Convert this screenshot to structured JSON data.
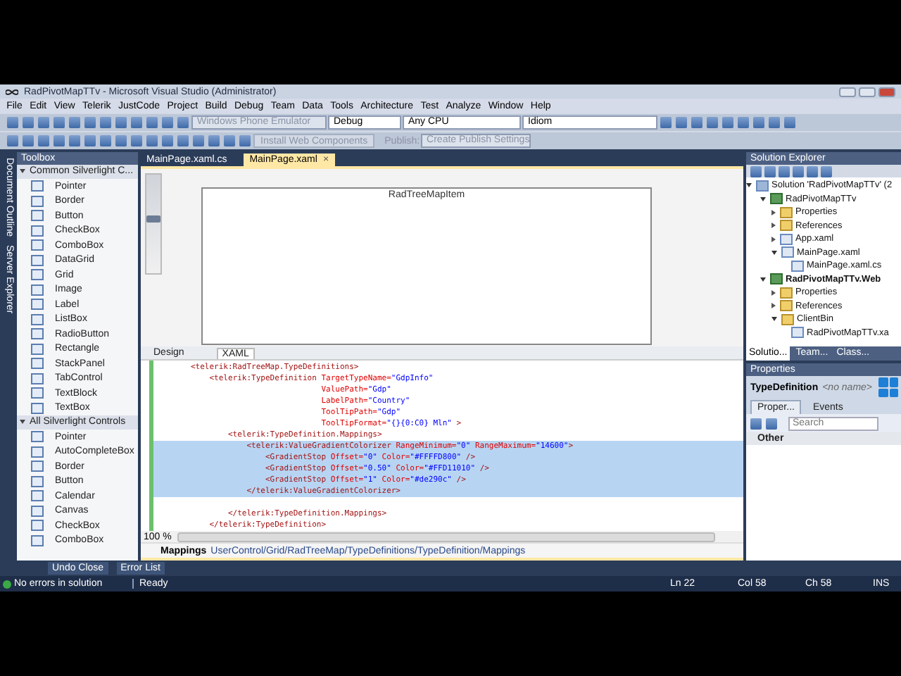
{
  "window": {
    "title": "RadPivotMapTTv - Microsoft Visual Studio (Administrator)"
  },
  "menu": [
    "File",
    "Edit",
    "View",
    "Telerik",
    "JustCode",
    "Project",
    "Build",
    "Debug",
    "Team",
    "Data",
    "Tools",
    "Architecture",
    "Test",
    "Analyze",
    "Window",
    "Help"
  ],
  "toolbar_1": {
    "combos": [
      {
        "value": "Windows Phone Emulator",
        "disabled": true
      },
      {
        "value": "Debug",
        "disabled": false
      },
      {
        "value": "Any CPU",
        "disabled": false
      },
      {
        "value": "Idiom",
        "disabled": false
      }
    ]
  },
  "toolbar_2": {
    "install_button": {
      "label": "Install Web Components",
      "disabled": true
    },
    "publish_label": "Publish:",
    "publish_combo": {
      "value": "Create Publish Settings",
      "disabled": true
    }
  },
  "side_tabs": [
    "Document Outline",
    "Server Explorer"
  ],
  "toolbox": {
    "title": "Toolbox",
    "groups": [
      {
        "label": "Common Silverlight C...",
        "expanded": true,
        "items": [
          "Pointer",
          "Border",
          "Button",
          "CheckBox",
          "ComboBox",
          "DataGrid",
          "Grid",
          "Image",
          "Label",
          "ListBox",
          "RadioButton",
          "Rectangle",
          "StackPanel",
          "TabControl",
          "TextBlock",
          "TextBox"
        ]
      },
      {
        "label": "All Silverlight Controls",
        "expanded": true,
        "items": [
          "Pointer",
          "AutoCompleteBox",
          "Border",
          "Button",
          "Calendar",
          "Canvas",
          "CheckBox",
          "ComboBox"
        ]
      }
    ]
  },
  "document_tabs": [
    {
      "label": "MainPage.xaml.cs",
      "selected": false
    },
    {
      "label": "MainPage.xaml",
      "selected": true,
      "close": "×"
    }
  ],
  "designer": {
    "item_label": "RadTreeMapItem",
    "zoom": {
      "level": 0.55
    }
  },
  "view_tabs": [
    {
      "label": "Design",
      "selected": false
    },
    {
      "label": "XAML",
      "selected": true
    }
  ],
  "code_lines": [
    {
      "selected": false,
      "tokens": [
        {
          "kind": "tag",
          "text": "        <telerik:RadTreeMap.TypeDefinitions>"
        }
      ]
    },
    {
      "selected": false,
      "tokens": [
        {
          "kind": "tag",
          "text": "            <telerik:TypeDefinition"
        },
        {
          "kind": "attr",
          "text": " TargetTypeName="
        },
        {
          "kind": "value",
          "text": "\"GdpInfo\""
        }
      ]
    },
    {
      "selected": false,
      "tokens": [
        {
          "kind": "attr",
          "text": "                                    ValuePath="
        },
        {
          "kind": "value",
          "text": "\"Gdp\""
        }
      ]
    },
    {
      "selected": false,
      "tokens": [
        {
          "kind": "attr",
          "text": "                                    LabelPath="
        },
        {
          "kind": "value",
          "text": "\"Country\""
        }
      ]
    },
    {
      "selected": false,
      "tokens": [
        {
          "kind": "attr",
          "text": "                                    ToolTipPath="
        },
        {
          "kind": "value",
          "text": "\"Gdp\""
        }
      ]
    },
    {
      "selected": false,
      "tokens": [
        {
          "kind": "attr",
          "text": "                                    ToolTipFormat="
        },
        {
          "kind": "value",
          "text": "\"{}{0:C0} Mln\""
        },
        {
          "kind": "tag",
          "text": " >"
        }
      ]
    },
    {
      "selected": false,
      "tokens": [
        {
          "kind": "tag",
          "text": "                <telerik:TypeDefinition.Mappings>"
        }
      ]
    },
    {
      "selected": true,
      "tokens": [
        {
          "kind": "tag",
          "text": "                    <telerik:ValueGradientColorizer"
        },
        {
          "kind": "attr",
          "text": " RangeMinimum="
        },
        {
          "kind": "value",
          "text": "\"0\""
        },
        {
          "kind": "attr",
          "text": " RangeMaximum="
        },
        {
          "kind": "value",
          "text": "\"14600\""
        },
        {
          "kind": "tag",
          "text": ">"
        }
      ]
    },
    {
      "selected": true,
      "tokens": [
        {
          "kind": "tag",
          "text": "                        <GradientStop"
        },
        {
          "kind": "attr",
          "text": " Offset="
        },
        {
          "kind": "value",
          "text": "\"0\""
        },
        {
          "kind": "attr",
          "text": " Color="
        },
        {
          "kind": "value",
          "text": "\"#FFFFD800\""
        },
        {
          "kind": "tag",
          "text": " />"
        }
      ]
    },
    {
      "selected": true,
      "tokens": [
        {
          "kind": "tag",
          "text": "                        <GradientStop"
        },
        {
          "kind": "attr",
          "text": " Offset="
        },
        {
          "kind": "value",
          "text": "\"0.50\""
        },
        {
          "kind": "attr",
          "text": " Color="
        },
        {
          "kind": "value",
          "text": "\"#FFD11010\""
        },
        {
          "kind": "tag",
          "text": " />"
        }
      ]
    },
    {
      "selected": true,
      "tokens": [
        {
          "kind": "tag",
          "text": "                        <GradientStop"
        },
        {
          "kind": "attr",
          "text": " Offset="
        },
        {
          "kind": "value",
          "text": "\"1\""
        },
        {
          "kind": "attr",
          "text": " Color="
        },
        {
          "kind": "value",
          "text": "\"#de290c\""
        },
        {
          "kind": "tag",
          "text": " />"
        }
      ]
    },
    {
      "selected": true,
      "tokens": [
        {
          "kind": "tag",
          "text": "                    </telerik:ValueGradientColorizer>"
        }
      ]
    },
    {
      "selected": false
    },
    {
      "selected": false,
      "tokens": [
        {
          "kind": "tag",
          "text": "                </telerik:TypeDefinition.Mappings>"
        }
      ]
    },
    {
      "selected": false,
      "tokens": [
        {
          "kind": "tag",
          "text": "            </telerik:TypeDefinition>"
        }
      ]
    }
  ],
  "zoom_level": "100 %",
  "breadcrumb": {
    "element": "Mappings",
    "path": "UserControl/Grid/RadTreeMap/TypeDefinitions/TypeDefinition/Mappings"
  },
  "solution_explorer": {
    "title": "Solution Explorer",
    "tree": [
      {
        "label": "Solution 'RadPivotMapTTv' (2",
        "kind": "solution",
        "bold": false,
        "expanded": true,
        "children": [
          {
            "label": "RadPivotMapTTv",
            "kind": "project",
            "bold": false,
            "expanded": true,
            "children": [
              {
                "label": "Properties",
                "kind": "folder",
                "bold": false,
                "expanded": false
              },
              {
                "label": "References",
                "kind": "folder",
                "bold": false,
                "expanded": false
              },
              {
                "label": "App.xaml",
                "kind": "file",
                "bold": false,
                "expanded": false
              },
              {
                "label": "MainPage.xaml",
                "kind": "file",
                "bold": false,
                "expanded": true,
                "children": [
                  {
                    "label": "MainPage.xaml.cs",
                    "kind": "file",
                    "bold": false
                  }
                ]
              }
            ]
          },
          {
            "label": "RadPivotMapTTv.Web",
            "kind": "project",
            "bold": true,
            "expanded": true,
            "children": [
              {
                "label": "Properties",
                "kind": "folder",
                "bold": false,
                "expanded": false
              },
              {
                "label": "References",
                "kind": "folder",
                "bold": false,
                "expanded": false
              },
              {
                "label": "ClientBin",
                "kind": "folder",
                "bold": false,
                "expanded": true,
                "children": [
                  {
                    "label": "RadPivotMapTTv.xa",
                    "kind": "file",
                    "bold": false
                  }
                ]
              }
            ]
          }
        ]
      }
    ],
    "tabs": [
      {
        "label": "Solutio...",
        "selected": true
      },
      {
        "label": "Team...",
        "selected": false
      },
      {
        "label": "Class...",
        "selected": false
      }
    ]
  },
  "properties": {
    "title": "Properties",
    "object_type": "TypeDefinition",
    "object_name": "<no name>",
    "tabs": [
      {
        "label": "Proper...",
        "selected": true
      },
      {
        "label": "Events",
        "selected": false
      }
    ],
    "search": {
      "placeholder": "Search"
    },
    "category": "Other"
  },
  "bottom_tabs": [
    "Undo Close",
    "Error List"
  ],
  "status_bar": {
    "errors": "No errors in solution",
    "state": "Ready",
    "line": "Ln 22",
    "column": "Col 58",
    "char": "Ch 58",
    "mode": "INS"
  }
}
